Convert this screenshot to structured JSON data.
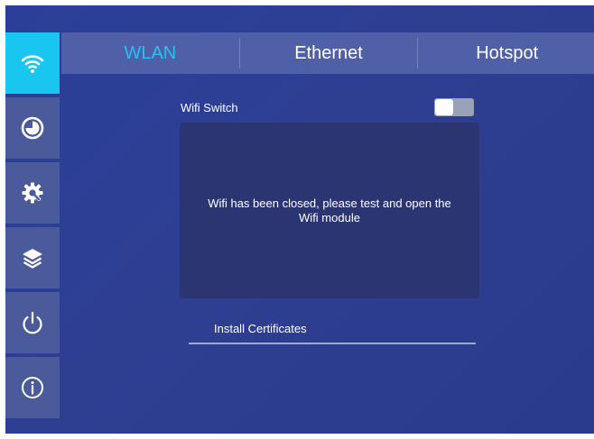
{
  "tabs": [
    {
      "label": "WLAN",
      "active": true
    },
    {
      "label": "Ethernet",
      "active": false
    },
    {
      "label": "Hotspot",
      "active": false
    }
  ],
  "sidebar": {
    "items": [
      {
        "icon": "wifi-icon",
        "active": true
      },
      {
        "icon": "clock-pie-icon",
        "active": false
      },
      {
        "icon": "gear-wrench-icon",
        "active": false
      },
      {
        "icon": "layers-icon",
        "active": false
      },
      {
        "icon": "power-icon",
        "active": false
      },
      {
        "icon": "info-icon",
        "active": false
      }
    ]
  },
  "wifi": {
    "switch_label": "Wifi Switch",
    "switch_on": false,
    "message": "Wifi has been closed, please test and open the Wifi module"
  },
  "certificates": {
    "label": "Install Certificates"
  },
  "colors": {
    "accent": "#18c6f0",
    "background": "#2b3f9a",
    "sidebar": "#4a5a9a",
    "panel": "#2b3572"
  }
}
